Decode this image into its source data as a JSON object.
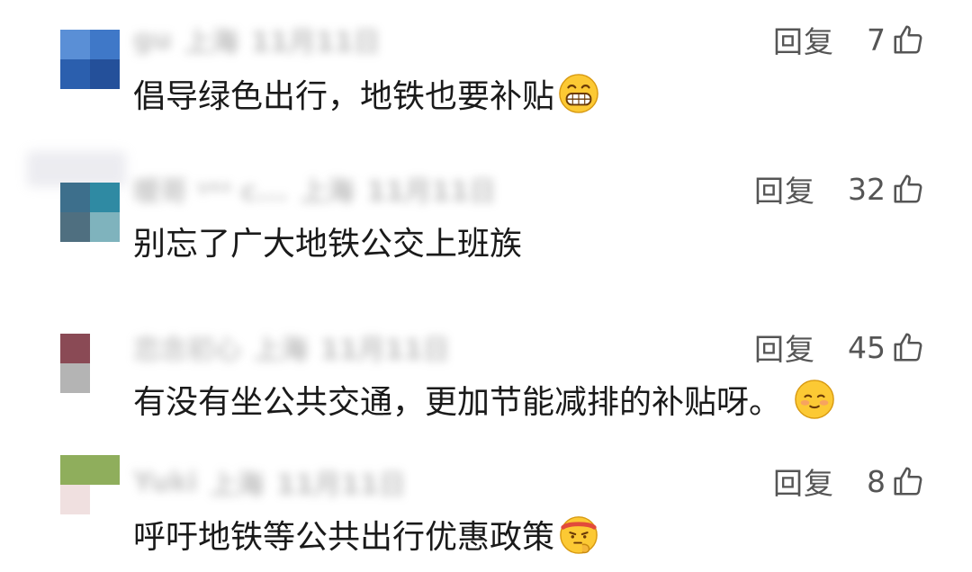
{
  "comments": [
    {
      "nickname": "gu",
      "location": "上海",
      "date": "11月11日",
      "reply_label": "回复",
      "likes": "7",
      "text": "倡导绿色出行，地铁也要补贴",
      "emoji": "grinning-face-icon",
      "avatar_colors": [
        "#5a8fd6",
        "#3f78c8",
        "#2b5fae",
        "#24509a"
      ]
    },
    {
      "nickname": "暖哥 ᵞᵉˢ c...",
      "location": "上海",
      "date": "11月11日",
      "reply_label": "回复",
      "likes": "32",
      "text": "别忘了广大地铁公交上班族",
      "emoji": "",
      "avatar_colors": [
        "#3d6f8c",
        "#2f8aa3",
        "#4f6f80",
        "#7fb3bd"
      ]
    },
    {
      "nickname": "恋念初心",
      "location": "上海",
      "date": "11月11日",
      "reply_label": "回复",
      "likes": "45",
      "text": "有没有坐公共交通，更加节能减排的补贴呀。",
      "emoji": "shy-smile-face-icon",
      "avatar_colors": [
        "#8a4a55",
        "#ffffff",
        "#b4b4b4",
        "#ffffff"
      ]
    },
    {
      "nickname": "Yuki",
      "location": "上海",
      "date": "11月11日",
      "reply_label": "回复",
      "likes": "8",
      "text": "呼吁地铁等公共出行优惠政策",
      "emoji": "thinking-face-icon",
      "avatar_colors": [
        "#8fae5c",
        "#8fae5c",
        "#f0e0e0",
        "#ffffff"
      ]
    }
  ],
  "icons": {
    "like": "thumbs-up-outline-icon"
  },
  "colors": {
    "text": "#1a1a1a",
    "action": "#555555",
    "background": "#ffffff"
  }
}
